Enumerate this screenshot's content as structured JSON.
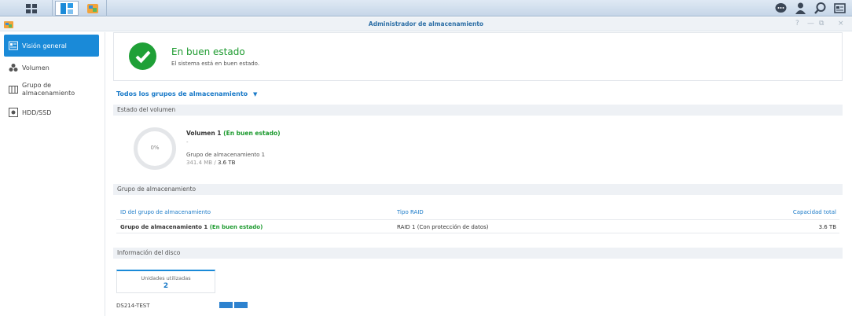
{
  "window": {
    "title": "Administrador de almacenamiento",
    "controls": [
      "?",
      "—",
      "⧉",
      "×"
    ]
  },
  "sidebar": {
    "items": [
      {
        "label": "Visión general",
        "icon": "overview-icon",
        "active": true
      },
      {
        "label": "Volumen",
        "icon": "volume-icon",
        "active": false
      },
      {
        "label": "Grupo de almacenamiento",
        "icon": "storage-pool-icon",
        "active": false
      },
      {
        "label": "HDD/SSD",
        "icon": "disk-icon",
        "active": false
      }
    ]
  },
  "status": {
    "title": "En buen estado",
    "subtitle": "El sistema está en buen estado."
  },
  "groups_filter": {
    "label": "Todos los grupos de almacenamiento",
    "caret": "▼"
  },
  "volume_section": {
    "header": "Estado del volumen",
    "usage_percent": "0%",
    "name": "Volumen 1",
    "state": "(En buen estado)",
    "description": "-",
    "pool": "Grupo de almacenamiento 1",
    "used": "341.4 MB",
    "separator": "/",
    "total": "3.6 TB"
  },
  "pool_section": {
    "header": "Grupo de almacenamiento",
    "columns": [
      "ID del grupo de almacenamiento",
      "Tipo RAID",
      "Capacidad total"
    ],
    "rows": [
      {
        "name": "Grupo de almacenamiento 1",
        "state": "(En buen estado)",
        "raid": "RAID 1 (Con protección de datos)",
        "capacity": "3.6 TB"
      }
    ]
  },
  "disk_section": {
    "header": "Información del disco",
    "card_label": "Unidades utilizadas",
    "card_value": "2",
    "host": "DS214-TEST"
  },
  "colors": {
    "accent": "#1a8ad8",
    "healthy": "#1c9a2e"
  }
}
